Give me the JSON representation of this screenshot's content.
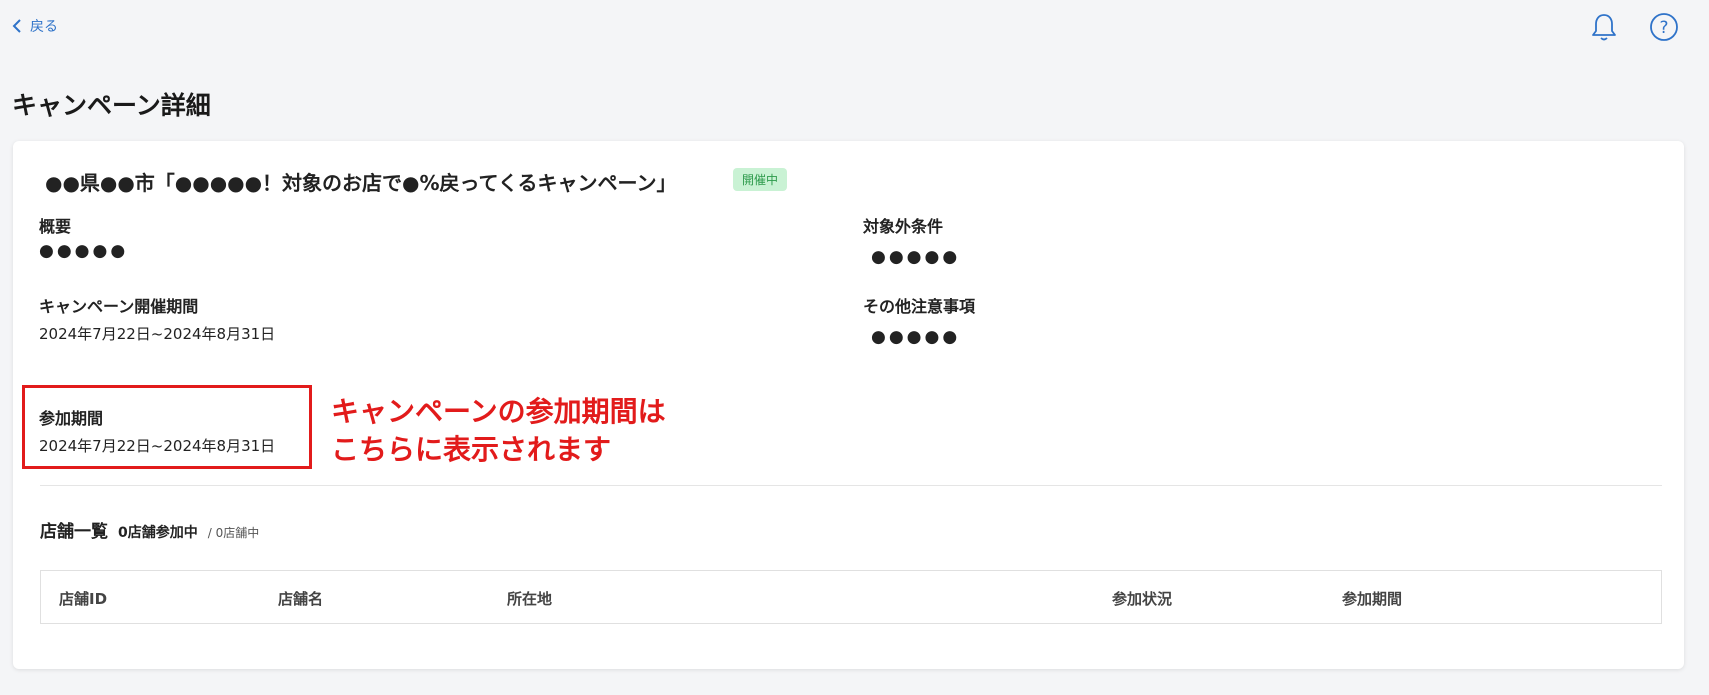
{
  "nav": {
    "back_label": "戻る"
  },
  "page_title": "キャンペーン詳細",
  "campaign": {
    "title": "●●県●●市「●●●●●！対象のお店で●%戻ってくるキャンペーン」",
    "status_badge": "開催中"
  },
  "fields": {
    "overview": {
      "label": "概要",
      "value": "●●●●●"
    },
    "excluded": {
      "label": "対象外条件",
      "value": "●●●●●"
    },
    "period": {
      "label": "キャンペーン開催期間",
      "value": "2024年7月22日~2024年8月31日"
    },
    "notes": {
      "label": "その他注意事項",
      "value": "●●●●●"
    },
    "participation": {
      "label": "参加期間",
      "value": "2024年7月22日~2024年8月31日"
    }
  },
  "annotation": {
    "line1": "キャンペーンの参加期間は",
    "line2": "こちらに表示されます",
    "color": "#e21b1b"
  },
  "stores": {
    "heading": "店舗一覧",
    "count_label": "0店舗参加中",
    "total_label": "/ 0店舗中",
    "columns": [
      "店舗ID",
      "店舗名",
      "所在地",
      "参加状況",
      "参加期間"
    ]
  },
  "icons": {
    "back": "chevron-left-icon",
    "notification": "bell-icon",
    "help": "help-circle-icon"
  },
  "colors": {
    "accent": "#2f73c9",
    "badge_bg": "#c9f2d4",
    "badge_text": "#2c9a4b",
    "annotation": "#e21b1b"
  }
}
